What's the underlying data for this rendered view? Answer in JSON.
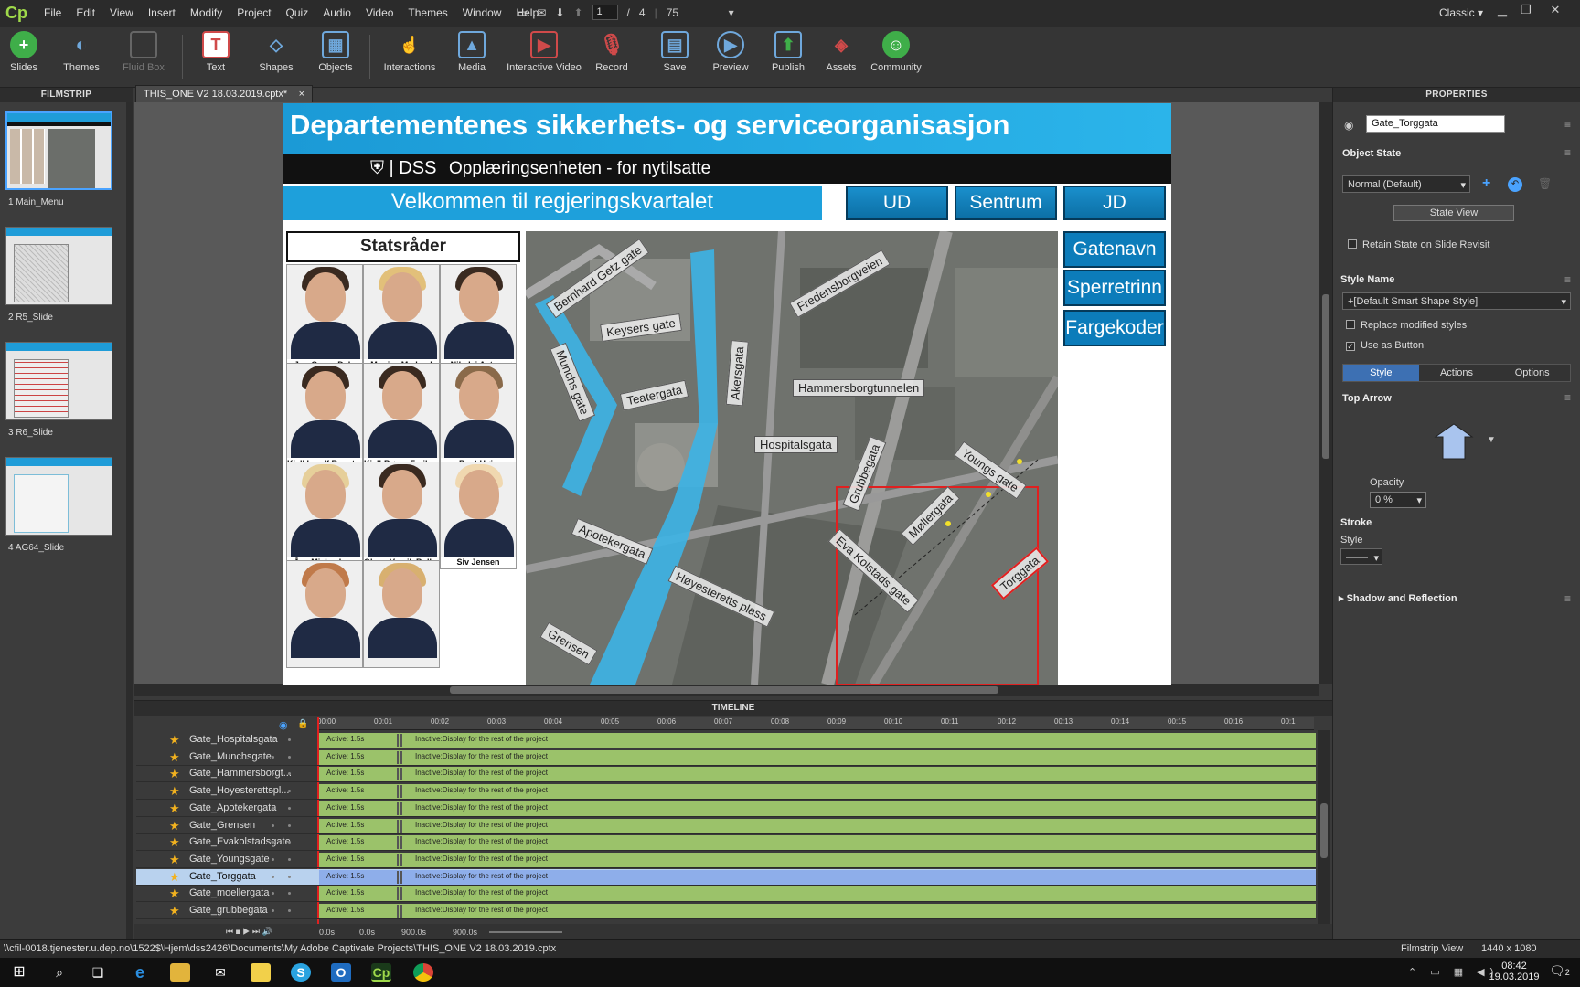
{
  "app": {
    "logo": "Cp",
    "workspace": "Classic"
  },
  "menu": [
    "File",
    "Edit",
    "View",
    "Insert",
    "Modify",
    "Project",
    "Quiz",
    "Audio",
    "Video",
    "Themes",
    "Window",
    "Help"
  ],
  "nav": {
    "current_page": "1",
    "separator": "/",
    "total_pages": "4",
    "zoom": "75"
  },
  "toolbar": {
    "slides": "Slides",
    "themes": "Themes",
    "fluid_box": "Fluid Box",
    "text": "Text",
    "shapes": "Shapes",
    "objects": "Objects",
    "interactions": "Interactions",
    "media": "Media",
    "interactive_video": "Interactive Video",
    "record": "Record",
    "save": "Save",
    "preview": "Preview",
    "publish": "Publish",
    "assets": "Assets",
    "community": "Community"
  },
  "filmstrip": {
    "title": "FILMSTRIP",
    "slides": [
      {
        "label": "1 Main_Menu"
      },
      {
        "label": "2 R5_Slide"
      },
      {
        "label": "3 R6_Slide"
      },
      {
        "label": "4 AG64_Slide"
      }
    ]
  },
  "doc_tab": {
    "title": "THIS_ONE V2 18.03.2019.cptx*",
    "close": "×"
  },
  "slide": {
    "title": "Departementenes sikkerhets- og serviceorganisasjon",
    "logo": "⛨ | DSS",
    "subtitle": "Opplæringsenheten - for nytilsatte",
    "welcome": "Velkommen til regjeringskvartalet",
    "nav_buttons": [
      "UD",
      "Sentrum",
      "JD"
    ],
    "side_buttons": [
      "Gatenavn",
      "Sperretrinn",
      "Fargekoder"
    ],
    "statsrader_title": "Statsråder",
    "people": [
      "Jon Georg Dale",
      "Monica Mæland",
      "Nikolai Astrup",
      "Kjell Ingolf Ropstad",
      "Kjell-Børge Freiberg",
      "Bent Høie",
      "Åse Michaelsen",
      "Olaug Vervik Bollestad",
      "Siv Jensen",
      "",
      ""
    ],
    "streets": [
      "Bernhard Getz gate",
      "Keysers gate",
      "Fredensborgveien",
      "Munchs gate",
      "Teatergata",
      "Akersgata",
      "Hammersborgtunnelen",
      "Hospitalsgata",
      "Grubbegata",
      "Youngs gate",
      "Møllergata",
      "Torggata",
      "Eva Kolstads gate",
      "Apotekergata",
      "Høyesteretts plass",
      "Grensen"
    ]
  },
  "properties": {
    "title": "PROPERTIES",
    "object_name": "Gate_Torggata",
    "object_state_label": "Object State",
    "state_value": "Normal (Default)",
    "state_view": "State View",
    "retain_state": "Retain State on Slide Revisit",
    "style_name_label": "Style Name",
    "style_value": "+[Default Smart Shape Style]",
    "replace_styles": "Replace modified styles",
    "use_as_button": "Use as Button",
    "tabs": [
      "Style",
      "Actions",
      "Options"
    ],
    "top_arrow": "Top Arrow",
    "opacity_label": "Opacity",
    "opacity_value": "0 %",
    "stroke_label": "Stroke",
    "style_label": "Style",
    "shadow": "Shadow and Reflection"
  },
  "timeline": {
    "title": "TIMELINE",
    "ticks": [
      "00:00",
      "00:01",
      "00:02",
      "00:03",
      "00:04",
      "00:05",
      "00:06",
      "00:07",
      "00:08",
      "00:09",
      "00:10",
      "00:11",
      "00:12",
      "00:13",
      "00:14",
      "00:15",
      "00:16",
      "00:1"
    ],
    "active_text": "Active: 1.5s",
    "inactive_text": "Inactive:Display for the rest of the project",
    "rows": [
      "Gate_Hospitalsgata",
      "Gate_Munchsgate",
      "Gate_Hammersborgt...",
      "Gate_Hoyesterettspl...",
      "Gate_Apotekergata",
      "Gate_Grensen",
      "Gate_Evakolstadsgate",
      "Gate_Youngsgate",
      "Gate_Torggata",
      "Gate_moellergata",
      "Gate_grubbegata"
    ],
    "selected_row": 8,
    "footer": [
      "0.0s",
      "0.0s",
      "900.0s",
      "900.0s"
    ]
  },
  "status": {
    "path": "\\\\cfil-0018.tjenester.u.dep.no\\1522$\\Hjem\\dss2426\\Documents\\My Adobe Captivate Projects\\THIS_ONE V2 18.03.2019.cptx",
    "view": "Filmstrip View",
    "resolution": "1440 x 1080"
  },
  "taskbar": {
    "time": "08:42",
    "date": "19.03.2019",
    "notif_count": "2"
  }
}
